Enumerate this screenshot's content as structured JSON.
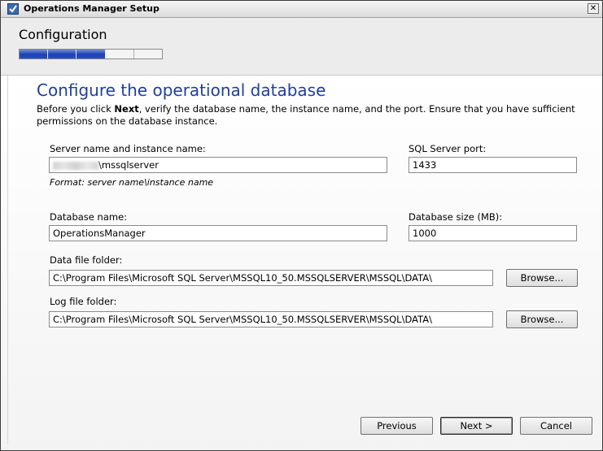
{
  "window": {
    "title": "Operations Manager Setup",
    "close_glyph": "✕"
  },
  "header": {
    "title": "Configuration",
    "progress": {
      "total_steps": 5,
      "completed_steps": 3
    }
  },
  "page": {
    "heading": "Configure the operational database",
    "desc_before": "Before you click ",
    "desc_bold": "Next",
    "desc_after": ", verify the database name, the instance name, and the port. Ensure that you have sufficient permissions on the database instance."
  },
  "fields": {
    "server_label": "Server name and instance name:",
    "server_value_suffix": "\\mssqlserver",
    "server_hint": "Format: server name\\instance name",
    "port_label": "SQL Server port:",
    "port_value": "1433",
    "dbname_label": "Database name:",
    "dbname_value": "OperationsManager",
    "dbsize_label": "Database size (MB):",
    "dbsize_value": "1000",
    "datafolder_label": "Data file folder:",
    "datafolder_value": "C:\\Program Files\\Microsoft SQL Server\\MSSQL10_50.MSSQLSERVER\\MSSQL\\DATA\\",
    "logfolder_label": "Log file folder:",
    "logfolder_value": "C:\\Program Files\\Microsoft SQL Server\\MSSQL10_50.MSSQLSERVER\\MSSQL\\DATA\\"
  },
  "buttons": {
    "browse_data": "Browse...",
    "browse_log": "Browse...",
    "previous": "Previous",
    "next": "Next >",
    "cancel": "Cancel"
  },
  "colors": {
    "heading": "#1f3f9a",
    "progress_fill": "#1d3fb0"
  }
}
